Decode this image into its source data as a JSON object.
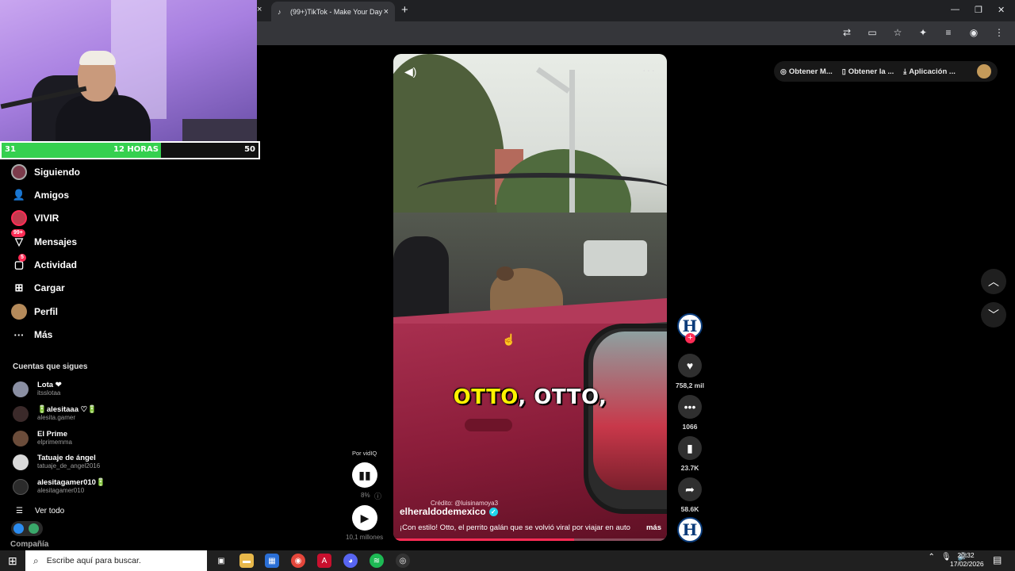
{
  "browser": {
    "tab_title": "(99+)TikTok - Make Your Day",
    "tab_close": "×",
    "left_tab_close": "×",
    "new_tab": "+",
    "window_controls": [
      "—",
      "❐",
      "✕"
    ]
  },
  "stream_overlay": {
    "left_value": "31",
    "center_label": "12 HORAS",
    "right_value": "50",
    "progress_fraction": 0.62
  },
  "sidebar": {
    "items": [
      {
        "label": "Siguiendo",
        "icon": "following-avatar-icon"
      },
      {
        "label": "Amigos",
        "icon": "friends-icon"
      },
      {
        "label": "VIVIR",
        "icon": "live-icon"
      },
      {
        "label": "Mensajes",
        "icon": "messages-icon",
        "badge": "99+"
      },
      {
        "label": "Actividad",
        "icon": "activity-icon",
        "badge": "5"
      },
      {
        "label": "Cargar",
        "icon": "upload-icon"
      },
      {
        "label": "Perfil",
        "icon": "profile-icon"
      },
      {
        "label": "Más",
        "icon": "more-icon"
      }
    ],
    "following_title": "Cuentas que sigues",
    "following": [
      {
        "name": "Lota ❤",
        "user": "itsslotaa"
      },
      {
        "name": "🔋alesitaaa ♡🔋",
        "user": "alesita.gamer"
      },
      {
        "name": "El Prime",
        "user": "elprimemma"
      },
      {
        "name": "Tatuaje de ángel",
        "user": "tatuaje_de_angel2016"
      },
      {
        "name": "alesitagamer010🔋",
        "user": "alesitagamer010"
      }
    ],
    "see_all": "Ver todo",
    "company": "Compañía"
  },
  "header": {
    "btn1": "Obtener M...",
    "btn2": "Obtener la ...",
    "btn3": "Aplicación ..."
  },
  "video": {
    "caption_a": "OTTO",
    "caption_b": ", OTTO,",
    "credit": "Crédito: @luisinamoya3",
    "author": "elheraldodemexico",
    "description": "¡Con estilo! Otto, el perrito galán que se volvió viral por viajar en auto",
    "more": "más",
    "progress_fraction": 0.66
  },
  "actions": {
    "avatar_letter": "H",
    "likes": "758,2 mil",
    "comments": "1066",
    "saves": "23.7K",
    "shares": "58.6K"
  },
  "vidiq": {
    "label": "Por vidIQ",
    "percent": "8%",
    "views": "10,1 millones"
  },
  "taskbar": {
    "search_placeholder": "Escribe aquí para buscar.",
    "time": "20:32",
    "date": "17/02/2026"
  },
  "colors": {
    "accent": "#fe2c55",
    "progress_green": "#35d04f",
    "verified": "#20d5ec"
  }
}
